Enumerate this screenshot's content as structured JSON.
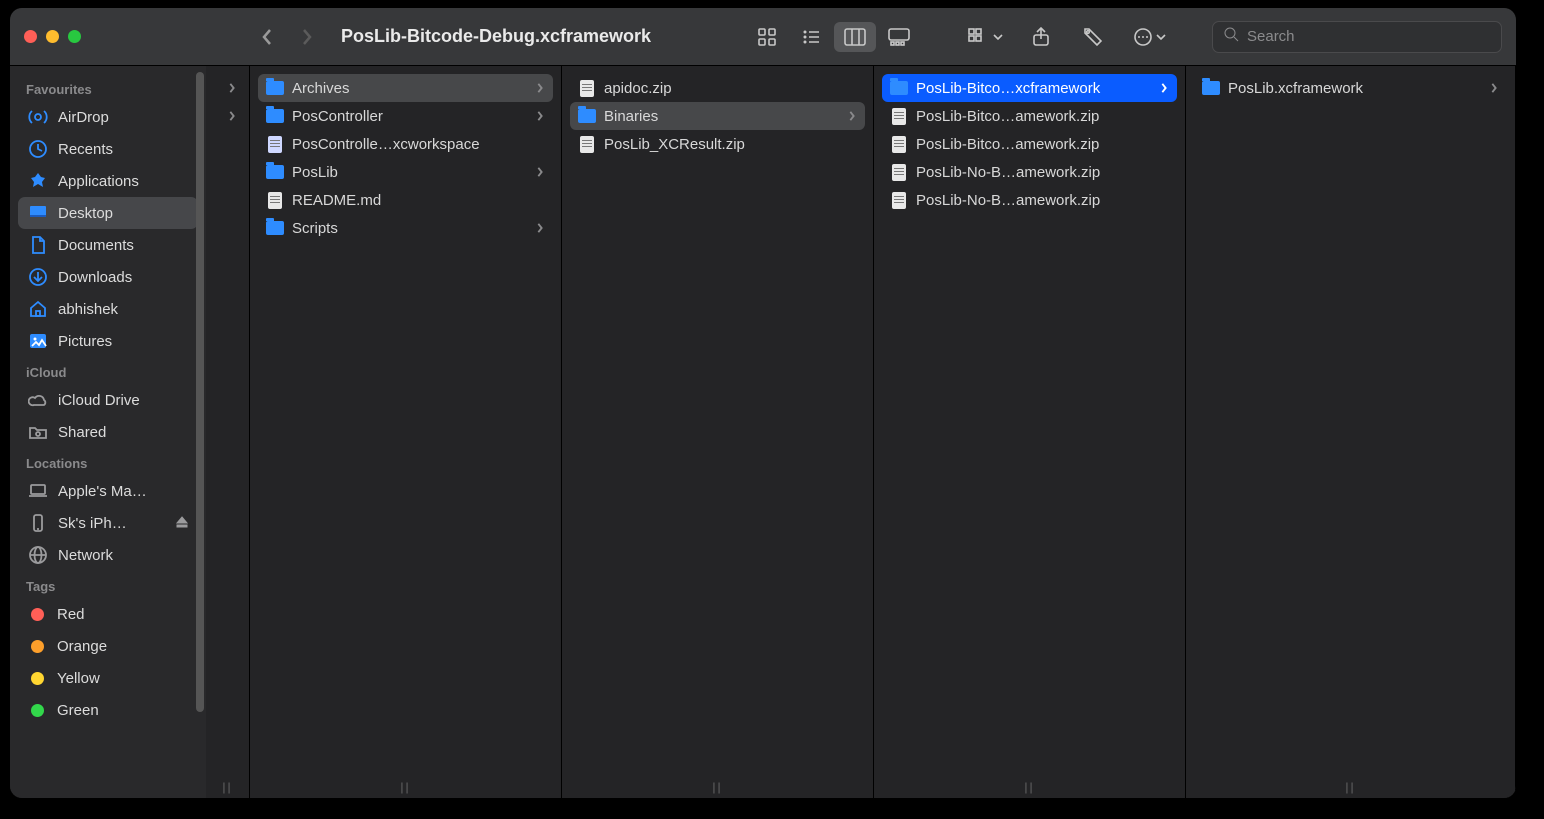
{
  "window": {
    "title": "PosLib-Bitcode-Debug.xcframework",
    "search_placeholder": "Search"
  },
  "sidebar": {
    "sections": [
      {
        "title": "Favourites",
        "items": [
          {
            "icon": "airdrop",
            "label": "AirDrop",
            "selected": false
          },
          {
            "icon": "recents",
            "label": "Recents",
            "selected": false
          },
          {
            "icon": "applications",
            "label": "Applications",
            "selected": false
          },
          {
            "icon": "desktop",
            "label": "Desktop",
            "selected": true
          },
          {
            "icon": "documents",
            "label": "Documents",
            "selected": false
          },
          {
            "icon": "downloads",
            "label": "Downloads",
            "selected": false
          },
          {
            "icon": "home",
            "label": "abhishek",
            "selected": false
          },
          {
            "icon": "pictures",
            "label": "Pictures",
            "selected": false
          }
        ]
      },
      {
        "title": "iCloud",
        "items": [
          {
            "icon": "cloud",
            "label": "iCloud Drive",
            "selected": false,
            "gray": true
          },
          {
            "icon": "shared",
            "label": "Shared",
            "selected": false,
            "gray": true
          }
        ]
      },
      {
        "title": "Locations",
        "items": [
          {
            "icon": "laptop",
            "label": "Apple's Ma…",
            "selected": false,
            "gray": true
          },
          {
            "icon": "phone",
            "label": "Sk's iPh…",
            "selected": false,
            "gray": true,
            "eject": true
          },
          {
            "icon": "network",
            "label": "Network",
            "selected": false,
            "gray": true
          }
        ]
      },
      {
        "title": "Tags",
        "items": [
          {
            "tagcolor": "#ff5f57",
            "label": "Red"
          },
          {
            "tagcolor": "#fd9f2b",
            "label": "Orange"
          },
          {
            "tagcolor": "#ffd631",
            "label": "Yellow"
          },
          {
            "tagcolor": "#32d74b",
            "label": "Green"
          }
        ]
      }
    ]
  },
  "columns": [
    {
      "narrow": true,
      "items": [
        {
          "type": "folder",
          "label": "",
          "chevron": true
        },
        {
          "type": "folder",
          "label": "",
          "chevron": true
        }
      ]
    },
    {
      "items": [
        {
          "type": "folder",
          "label": "Archives",
          "chevron": true,
          "state": "pathsel"
        },
        {
          "type": "folder",
          "label": "PosController",
          "chevron": true
        },
        {
          "type": "workspace",
          "label": "PosControlle…xcworkspace"
        },
        {
          "type": "folder",
          "label": "PosLib",
          "chevron": true
        },
        {
          "type": "doc",
          "label": "README.md"
        },
        {
          "type": "folder",
          "label": "Scripts",
          "chevron": true
        }
      ]
    },
    {
      "items": [
        {
          "type": "doc",
          "label": "apidoc.zip"
        },
        {
          "type": "folder",
          "label": "Binaries",
          "chevron": true,
          "state": "pathsel"
        },
        {
          "type": "doc",
          "label": "PosLib_XCResult.zip"
        }
      ]
    },
    {
      "items": [
        {
          "type": "folder",
          "label": "PosLib-Bitco…xcframework",
          "chevron": true,
          "state": "sel"
        },
        {
          "type": "doc",
          "label": "PosLib-Bitco…amework.zip"
        },
        {
          "type": "doc",
          "label": "PosLib-Bitco…amework.zip"
        },
        {
          "type": "doc",
          "label": "PosLib-No-B…amework.zip"
        },
        {
          "type": "doc",
          "label": "PosLib-No-B…amework.zip"
        }
      ]
    },
    {
      "items": [
        {
          "type": "folder",
          "label": "PosLib.xcframework",
          "chevron": true
        }
      ]
    }
  ]
}
